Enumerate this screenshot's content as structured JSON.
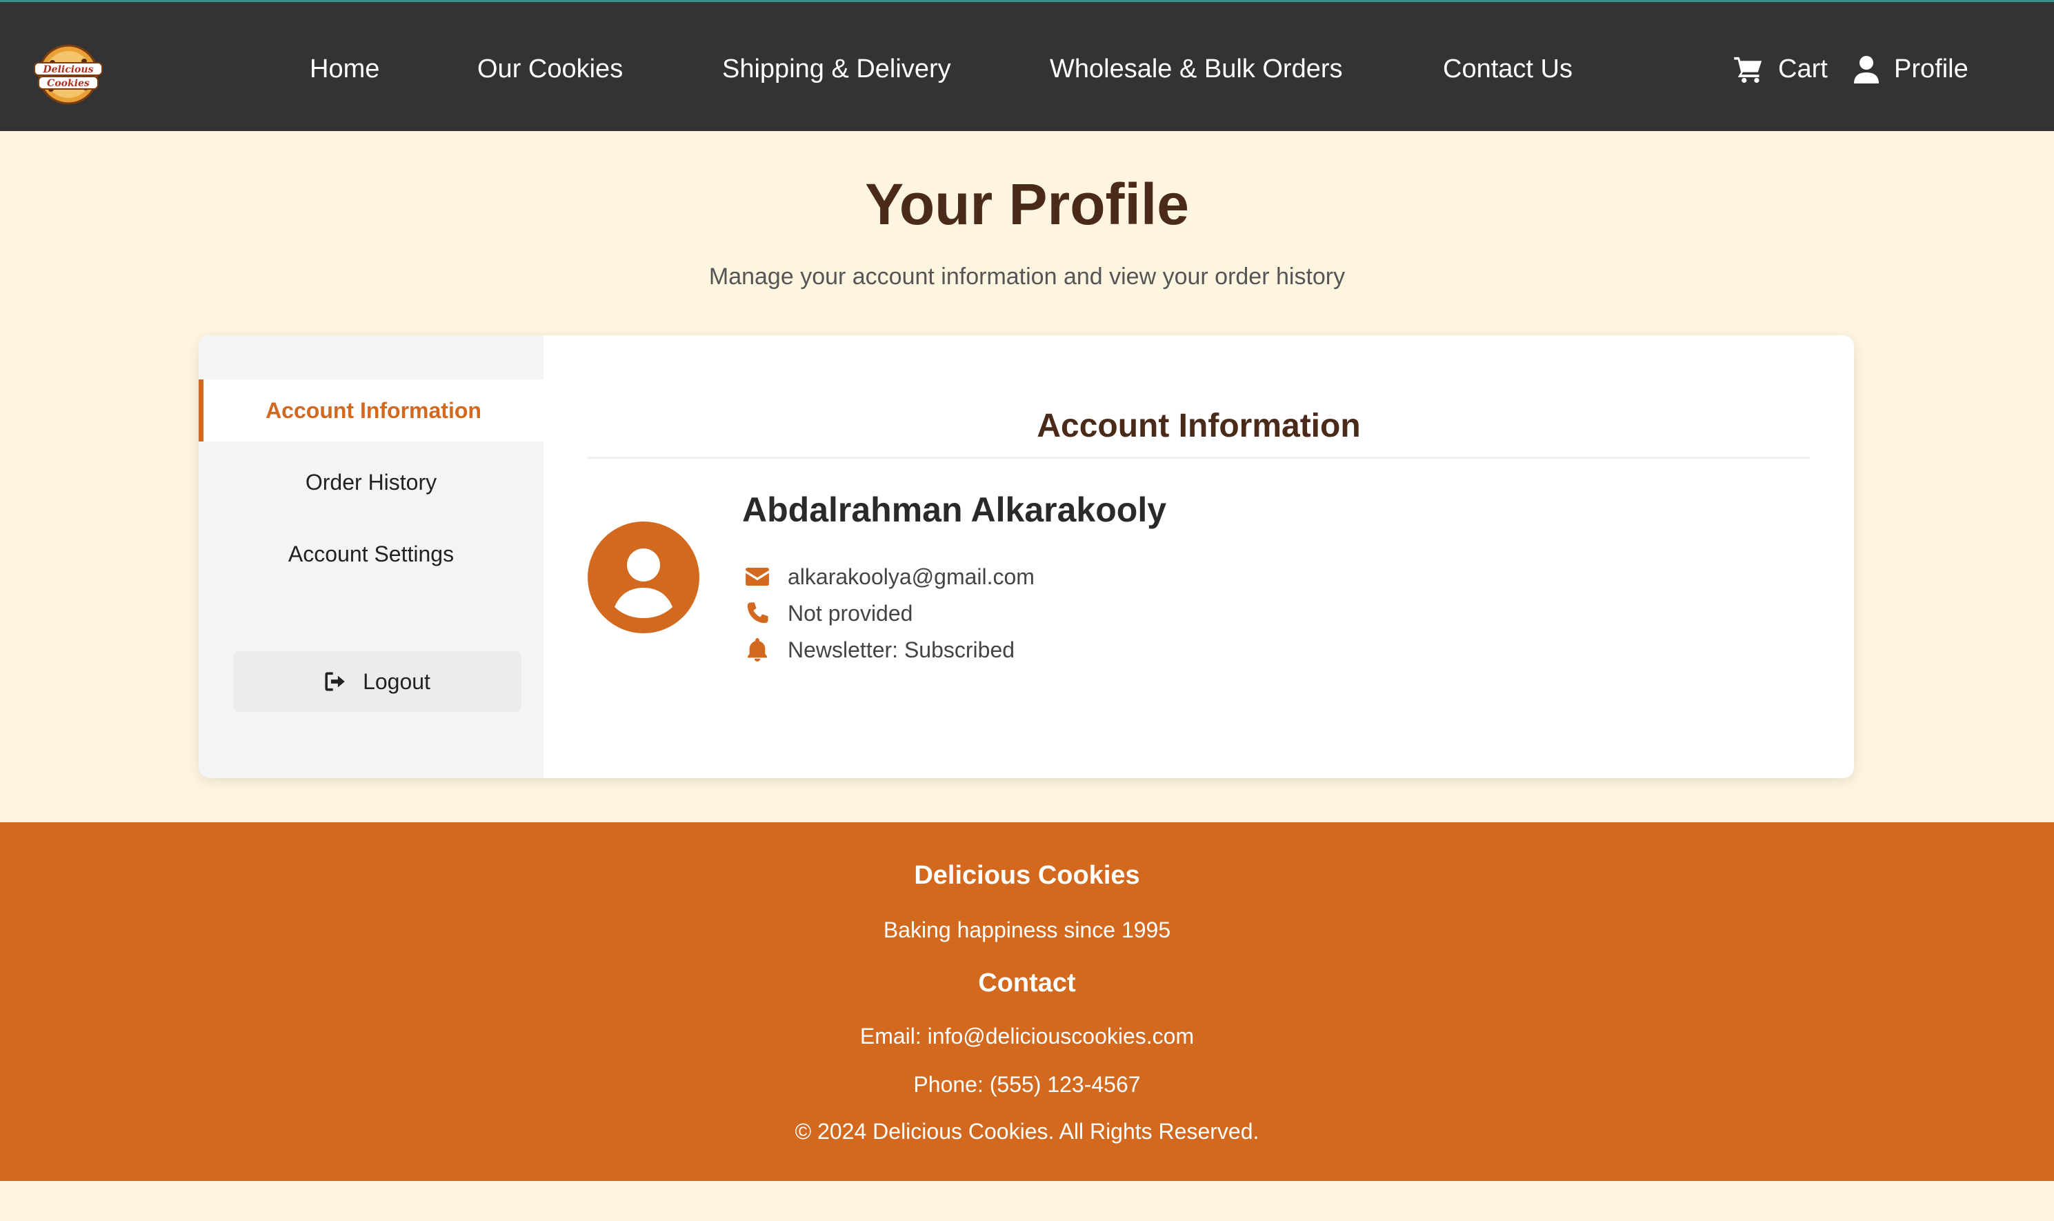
{
  "brand": {
    "logo_text_top": "Delicious",
    "logo_text_bottom": "Cookies"
  },
  "nav": {
    "links": [
      "Home",
      "Our Cookies",
      "Shipping & Delivery",
      "Wholesale & Bulk Orders",
      "Contact Us"
    ],
    "cart_label": "Cart",
    "profile_label": "Profile"
  },
  "header": {
    "title": "Your Profile",
    "subtitle": "Manage your account information and view your order history"
  },
  "sidebar": {
    "items": [
      {
        "label": "Account Information",
        "active": true
      },
      {
        "label": "Order History",
        "active": false
      },
      {
        "label": "Account Settings",
        "active": false
      }
    ],
    "logout_label": "Logout"
  },
  "account": {
    "section_title": "Account Information",
    "name": "Abdalrahman Alkarakooly",
    "email": "alkarakoolya@gmail.com",
    "phone": "Not provided",
    "newsletter": "Newsletter: Subscribed"
  },
  "footer": {
    "company": "Delicious Cookies",
    "tagline": "Baking happiness since 1995",
    "contact_heading": "Contact",
    "email_line": "Email: info@deliciouscookies.com",
    "phone_line": "Phone: (555) 123-4567",
    "copyright": "© 2024 Delicious Cookies. All Rights Reserved."
  },
  "colors": {
    "accent": "#d2691e",
    "nav_bg": "#333333",
    "page_bg": "#fdf5e0",
    "title_brown": "#4a2a18"
  },
  "icons": [
    "cart-icon",
    "user-icon",
    "logout-icon",
    "envelope-icon",
    "phone-icon",
    "bell-icon",
    "avatar-icon"
  ]
}
